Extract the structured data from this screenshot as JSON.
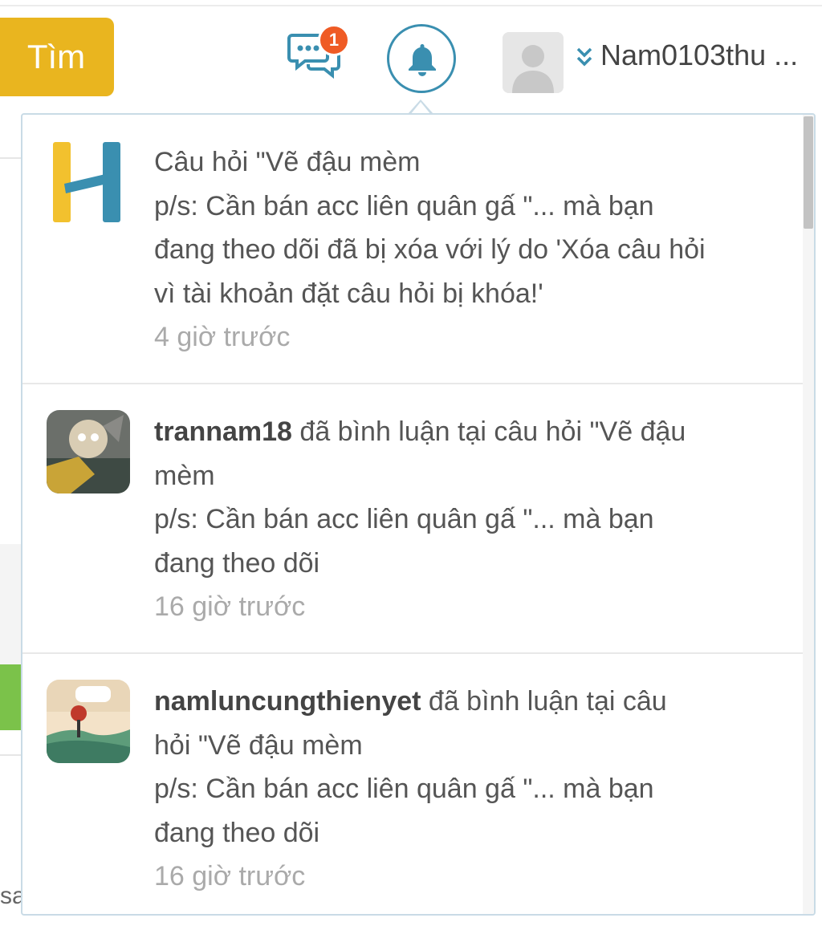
{
  "header": {
    "search_label": "Tìm",
    "messages_badge": "1",
    "username": "Nam0103thu ..."
  },
  "notifications": [
    {
      "user": "",
      "text_lines": [
        "Câu hỏi \"Vẽ đậu mèm",
        "p/s: Cần bán acc liên quân gấ \"... mà bạn",
        "đang theo dõi đã bị xóa với lý do 'Xóa câu hỏi",
        "vì tài khoản đặt câu hỏi bị khóa!'"
      ],
      "time": "4 giờ trước"
    },
    {
      "user": "trannam18",
      "first_line_rest": " đã bình luận tại câu hỏi \"Vẽ đậu",
      "text_lines": [
        "mèm",
        "p/s: Cần bán acc liên quân gấ \"... mà bạn",
        "đang theo dõi"
      ],
      "time": "16 giờ trước"
    },
    {
      "user": "namluncungthienyet",
      "first_line_rest": " đã bình luận tại câu",
      "text_lines": [
        "hỏi \"Vẽ đậu mèm",
        "p/s: Cần bán acc liên quân gấ \"... mà bạn",
        "đang theo dõi"
      ],
      "time": "16 giờ trước"
    }
  ],
  "background": {
    "partial_text": "sa"
  },
  "colors": {
    "accent_yellow": "#e9b51f",
    "accent_blue": "#3a8fb0",
    "badge_orange": "#ef5b25",
    "green": "#7bc24a"
  },
  "icons": {
    "messages": "chat-bubbles-icon",
    "notifications": "bell-icon",
    "dropdown": "chevron-double-down-icon",
    "site_logo": "h-logo-icon"
  }
}
